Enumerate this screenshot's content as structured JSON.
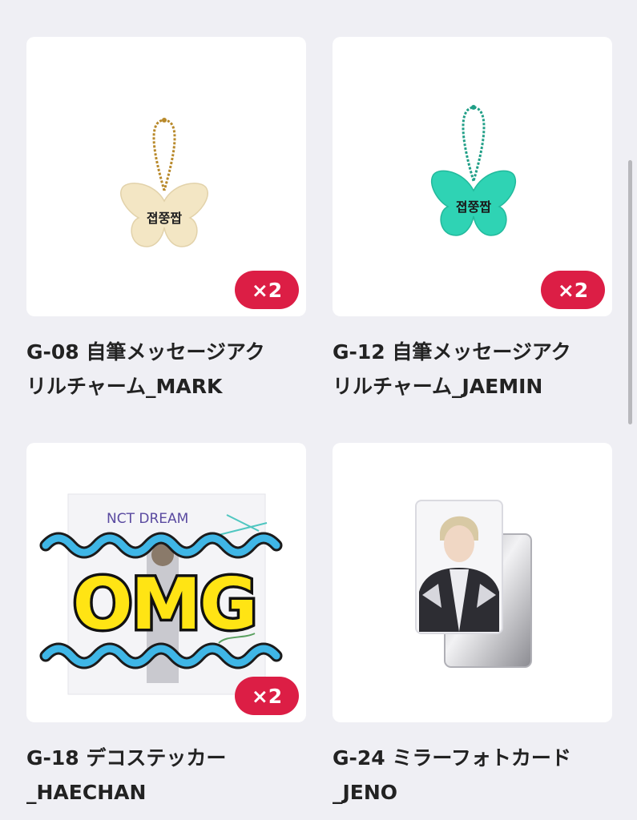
{
  "colors": {
    "background": "#efeff4",
    "badge": "#dc1e45",
    "title_text": "#222222"
  },
  "products": [
    {
      "image_icon": "butterfly-charm-cream-icon",
      "badge": "×2",
      "title_line1": "G-08 自筆メッセージアク",
      "title_line2": "リルチャーム_MARK",
      "charm_text": "졉쭝짭"
    },
    {
      "image_icon": "butterfly-charm-teal-icon",
      "badge": "×2",
      "title_line1": "G-12 自筆メッセージアク",
      "title_line2": "リルチャーム_JAEMIN",
      "charm_text": "졉쭝짭"
    },
    {
      "image_icon": "deco-sticker-icon",
      "badge": "×2",
      "title_line1": "G-18 デコステッカー",
      "title_line2": "_HAECHAN",
      "sticker_header": "NCT DREAM",
      "overlay_text": "OMG"
    },
    {
      "image_icon": "mirror-photocard-icon",
      "badge": "",
      "title_line1": "G-24 ミラーフォトカード",
      "title_line2": "_JENO"
    }
  ]
}
